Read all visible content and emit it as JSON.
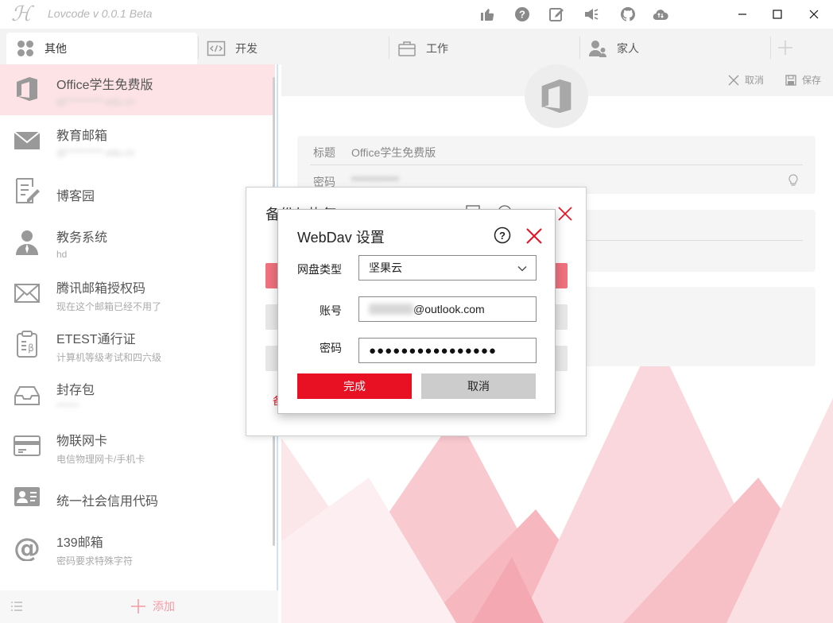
{
  "window": {
    "app_title": "Lovcode  v 0.0.1 Beta",
    "toolbar_icons": [
      "thumbs-up-icon",
      "help-icon",
      "edit-icon",
      "announcement-icon",
      "github-icon",
      "cloud-sync-icon"
    ],
    "controls": [
      "minimize",
      "maximize",
      "close"
    ]
  },
  "tabs": [
    {
      "label": "其他",
      "icon": "grid-icon",
      "active": true
    },
    {
      "label": "开发",
      "icon": "code-icon",
      "active": false
    },
    {
      "label": "工作",
      "icon": "briefcase-icon",
      "active": false
    },
    {
      "label": "家人",
      "icon": "family-icon",
      "active": false
    }
  ],
  "sidebar": {
    "items": [
      {
        "title": "Office学生免费版",
        "subtitle": "@**********.edu.cn",
        "icon": "office-icon",
        "active": true
      },
      {
        "title": "教育邮箱",
        "subtitle": "@**********.edu.cn",
        "icon": "mail-icon"
      },
      {
        "title": "博客园",
        "subtitle": "",
        "icon": "note-edit-icon"
      },
      {
        "title": "教务系统",
        "subtitle": "hd",
        "icon": "user-icon"
      },
      {
        "title": "腾讯邮箱授权码",
        "subtitle": "现在这个邮箱已经不用了",
        "icon": "mail-outline-icon"
      },
      {
        "title": "ETEST通行证",
        "subtitle": "计算机等级考试和四六级",
        "icon": "clipboard-icon"
      },
      {
        "title": "封存包",
        "subtitle": "******",
        "icon": "inbox-icon"
      },
      {
        "title": "物联网卡",
        "subtitle": "电信物理网卡/手机卡",
        "icon": "card-icon"
      },
      {
        "title": "统一社会信用代码",
        "subtitle": "",
        "icon": "id-card-icon"
      },
      {
        "title": "139邮箱",
        "subtitle": "密码要求特殊字符",
        "icon": "at-icon"
      }
    ],
    "add_label": "添加"
  },
  "detail": {
    "cancel_label": "取消",
    "save_label": "保存",
    "title_label": "标题",
    "title_value": "Office学生免费版",
    "password_label": "密码",
    "password_value": "***********"
  },
  "backup_dialog": {
    "title": "备份与恢复",
    "footer_text": "备"
  },
  "webdav_dialog": {
    "title": "WebDav 设置",
    "disk_type_label": "网盘类型",
    "disk_type_value": "坚果云",
    "account_label": "账号",
    "account_value": "@outlook.com",
    "password_label": "密码",
    "password_value": "●●●●●●●●●●●●●●●●",
    "confirm_label": "完成",
    "cancel_label": "取消"
  },
  "colors": {
    "accent": "#e81123",
    "sidebar_active": "#fde3e6",
    "backup_bar": "#f0727e"
  }
}
